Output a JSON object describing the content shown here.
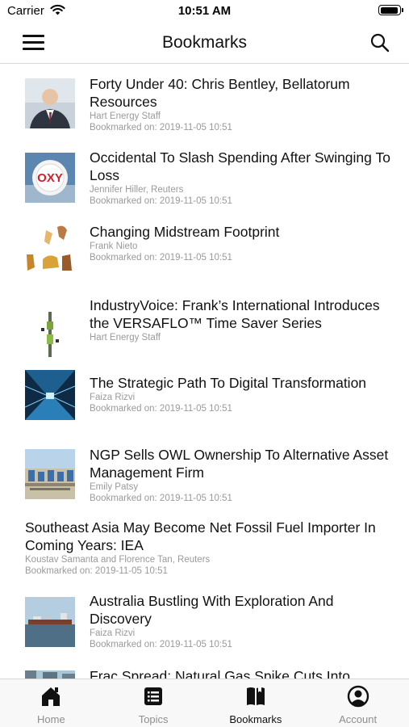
{
  "status_bar": {
    "carrier": "Carrier",
    "time": "10:51 AM"
  },
  "nav": {
    "title": "Bookmarks",
    "menu_icon": "hamburger-icon",
    "search_icon": "search-icon"
  },
  "articles": [
    {
      "title": "Forty Under 40: Chris Bentley, Bellatorum Resources",
      "author": "Hart Energy Staff",
      "bookmarked": "Bookmarked on: 2019-11-05 10:51"
    },
    {
      "title": "Occidental To Slash Spending After Swinging To Loss",
      "author": "Jennifer Hiller, Reuters",
      "bookmarked": "Bookmarked on: 2019-11-05 10:51"
    },
    {
      "title": "Changing Midstream Footprint",
      "author": "Frank Nieto",
      "bookmarked": "Bookmarked on: 2019-11-05 10:51"
    },
    {
      "title": "IndustryVoice: Frank’s International Introduces the VERSAFLO™ Time Saver Series",
      "author": "Hart Energy Staff",
      "bookmarked": ""
    },
    {
      "title": "The Strategic Path To Digital Transformation",
      "author": "Faiza Rizvi",
      "bookmarked": "Bookmarked on: 2019-11-05 10:51"
    },
    {
      "title": "NGP Sells OWL Ownership To Alternative Asset Management Firm",
      "author": "Emily Patsy",
      "bookmarked": "Bookmarked on: 2019-11-05 10:51"
    },
    {
      "title": "Southeast Asia May Become Net Fossil Fuel Importer In Coming Years: IEA",
      "author": "Koustav Samanta and Florence Tan, Reuters",
      "bookmarked": "Bookmarked on: 2019-11-05 10:51"
    },
    {
      "title": "Australia Bustling With Exploration And Discovery",
      "author": "Faiza Rizvi",
      "bookmarked": "Bookmarked on: 2019-11-05 10:51"
    },
    {
      "title": "Frac Spread: Natural Gas Spike Cuts Into",
      "author": "",
      "bookmarked": ""
    }
  ],
  "tabs": [
    {
      "label": "Home",
      "icon": "home-icon",
      "active": false
    },
    {
      "label": "Topics",
      "icon": "list-icon",
      "active": false
    },
    {
      "label": "Bookmarks",
      "icon": "book-icon",
      "active": true
    },
    {
      "label": "Account",
      "icon": "account-icon",
      "active": false
    }
  ],
  "colors": {
    "active_tab": "#111111",
    "inactive_tab": "#8e8e8e",
    "meta_text": "#9a9a9a"
  }
}
